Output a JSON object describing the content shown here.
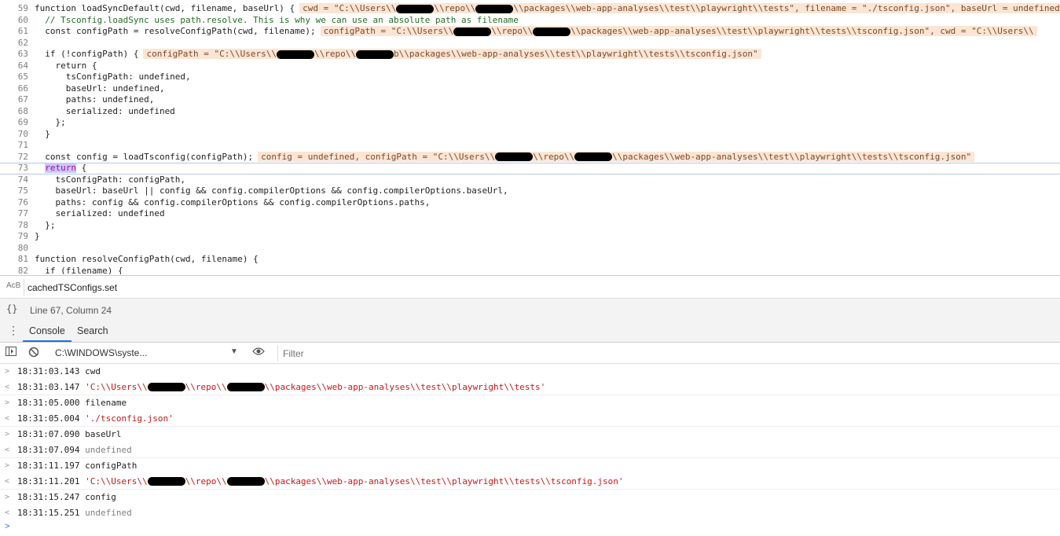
{
  "editor": {
    "lines": [
      {
        "n": "59",
        "code": "function loadSyncDefault(cwd, filename, baseUrl) {",
        "inline": "cwd = \"C:\\\\Users\\\\",
        "inline2": "\\\\repo\\\\",
        "inline3": "\\\\packages\\\\web-app-analyses\\\\test\\\\playwright\\\\tests\", filename = \"./tsconfig.json\", baseUrl = undefined"
      },
      {
        "n": "60",
        "code": "  // Tsconfig.loadSync uses path.resolve. This is why we can use an absolute path as filename"
      },
      {
        "n": "61",
        "code": "  const configPath = resolveConfigPath(cwd, filename);",
        "inline": "configPath = \"C:\\\\Users\\\\",
        "inline2": "\\\\repo\\\\",
        "inline3": "\\\\packages\\\\web-app-analyses\\\\test\\\\playwright\\\\tests\\\\tsconfig.json\", cwd = \"C:\\\\Users\\\\"
      },
      {
        "n": "62",
        "code": ""
      },
      {
        "n": "63",
        "code": "  if (!configPath) {",
        "inline": "configPath = \"C:\\\\Users\\\\",
        "inline2": "\\\\repo\\\\",
        "inline3": "b\\\\packages\\\\web-app-analyses\\\\test\\\\playwright\\\\tests\\\\tsconfig.json\""
      },
      {
        "n": "64",
        "code": "    return {"
      },
      {
        "n": "65",
        "code": "      tsConfigPath: undefined,"
      },
      {
        "n": "66",
        "code": "      baseUrl: undefined,"
      },
      {
        "n": "67",
        "code": "      paths: undefined,"
      },
      {
        "n": "68",
        "code": "      serialized: undefined"
      },
      {
        "n": "69",
        "code": "    };"
      },
      {
        "n": "70",
        "code": "  }"
      },
      {
        "n": "71",
        "code": ""
      },
      {
        "n": "72",
        "code": "  const config = loadTsconfig(configPath);",
        "inline": "config = undefined, configPath = \"C:\\\\Users\\\\",
        "inline2": "\\\\repo\\\\",
        "inline3": "\\\\packages\\\\web-app-analyses\\\\test\\\\playwright\\\\tests\\\\tsconfig.json\""
      },
      {
        "n": "73",
        "code": "  return {",
        "current": true
      },
      {
        "n": "74",
        "code": "    tsConfigPath: configPath,"
      },
      {
        "n": "75",
        "code": "    baseUrl: baseUrl || config && config.compilerOptions && config.compilerOptions.baseUrl,"
      },
      {
        "n": "76",
        "code": "    paths: config && config.compilerOptions && config.compilerOptions.paths,"
      },
      {
        "n": "77",
        "code": "    serialized: undefined"
      },
      {
        "n": "78",
        "code": "  };"
      },
      {
        "n": "79",
        "code": "}"
      },
      {
        "n": "80",
        "code": ""
      },
      {
        "n": "81",
        "code": "function resolveConfigPath(cwd, filename) {"
      },
      {
        "n": "82",
        "code": "  if (filename) {"
      }
    ]
  },
  "search": {
    "value": "cachedTSConfigs.set",
    "ab_label": "AᴄB"
  },
  "status": {
    "braces": "{}",
    "position": "Line 67, Column 24"
  },
  "drawer": {
    "tabs": [
      {
        "label": "Console"
      },
      {
        "label": "Search"
      }
    ]
  },
  "console_toolbar": {
    "context": "C:\\WINDOWS\\syste...",
    "filter_placeholder": "Filter"
  },
  "console": {
    "messages": [
      {
        "dir": ">",
        "time": "18:31:03.143",
        "text": "cwd",
        "kind": "in"
      },
      {
        "dir": "<",
        "time": "18:31:03.147",
        "text": "'C:\\\\Users\\\\",
        "text2": "\\\\repo\\\\",
        "text3": "\\\\packages\\\\web-app-analyses\\\\test\\\\playwright\\\\tests'",
        "kind": "str"
      },
      {
        "dir": ">",
        "time": "18:31:05.000",
        "text": "filename",
        "kind": "in"
      },
      {
        "dir": "<",
        "time": "18:31:05.004",
        "text": "'./tsconfig.json'",
        "kind": "strplain"
      },
      {
        "dir": ">",
        "time": "18:31:07.090",
        "text": "baseUrl",
        "kind": "in"
      },
      {
        "dir": "<",
        "time": "18:31:07.094",
        "text": "undefined",
        "kind": "undef"
      },
      {
        "dir": ">",
        "time": "18:31:11.197",
        "text": "configPath",
        "kind": "in"
      },
      {
        "dir": "<",
        "time": "18:31:11.201",
        "text": "'C:\\\\Users\\\\",
        "text2": "\\\\repo\\\\",
        "text3": "\\\\packages\\\\web-app-analyses\\\\test\\\\playwright\\\\tests\\\\tsconfig.json'",
        "kind": "str"
      },
      {
        "dir": ">",
        "time": "18:31:15.247",
        "text": "config",
        "kind": "in"
      },
      {
        "dir": "<",
        "time": "18:31:15.251",
        "text": "undefined",
        "kind": "undef"
      }
    ],
    "prompt": ">"
  }
}
